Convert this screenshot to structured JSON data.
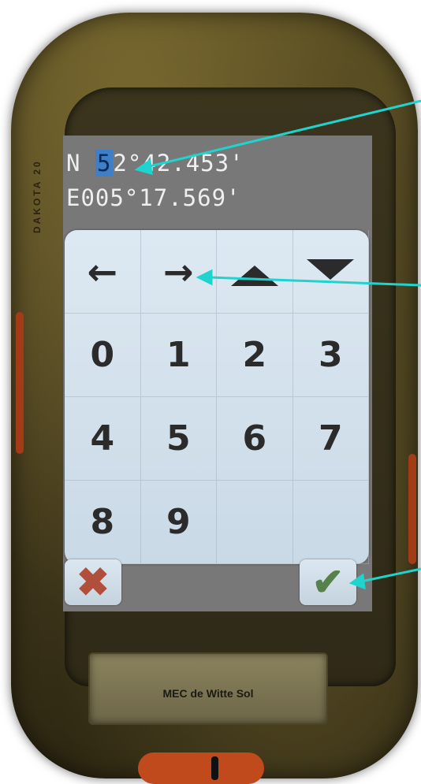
{
  "screen": {
    "latitude": {
      "hemisphere": "N",
      "cursor_digit": "5",
      "rest": "2°42.453'"
    },
    "longitude": "E005°17.569'"
  },
  "keypad": {
    "arrow_left": "←",
    "arrow_right": "→",
    "row2": [
      "0",
      "1",
      "2",
      "3"
    ],
    "row3": [
      "4",
      "5",
      "6",
      "7"
    ],
    "row4": [
      "8",
      "9"
    ]
  },
  "buttons": {
    "cancel": "✖",
    "ok": "✔"
  },
  "device": {
    "model_label": "DAKOTA 20",
    "nameplate": "MEC de Witte Sol"
  },
  "colors": {
    "annotation": "#1fd3cf",
    "cursor_highlight": "#3f7fc8"
  }
}
